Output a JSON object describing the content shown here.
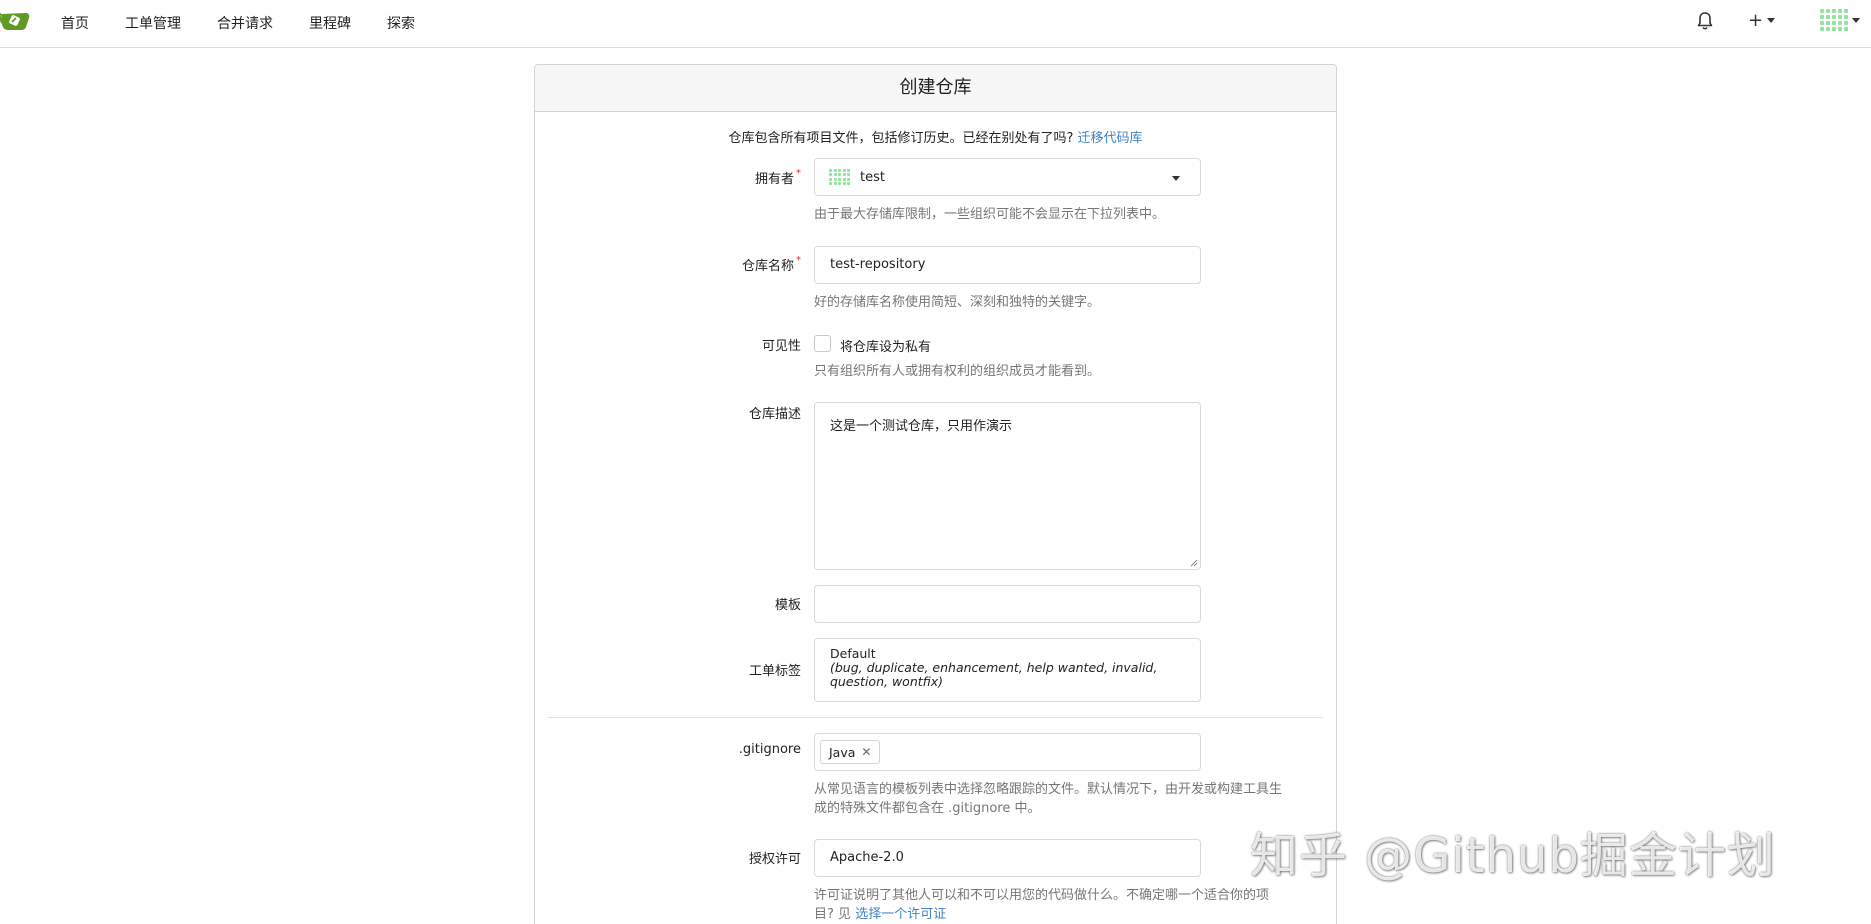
{
  "nav": {
    "items": [
      "首页",
      "工单管理",
      "合并请求",
      "里程碑",
      "探索"
    ],
    "plus_icon": "+"
  },
  "form": {
    "title": "创建仓库",
    "intro_text": "仓库包含所有项目文件，包括修订历史。已经在别处有了吗?",
    "intro_link": "迁移代码库",
    "owner": {
      "label": "拥有者",
      "required_mark": "*",
      "value": "test",
      "help": "由于最大存储库限制，一些组织可能不会显示在下拉列表中。"
    },
    "repo_name": {
      "label": "仓库名称",
      "required_mark": "*",
      "value": "test-repository",
      "help": "好的存储库名称使用简短、深刻和独特的关键字。"
    },
    "visibility": {
      "label": "可见性",
      "checkbox_label": "将仓库设为私有",
      "checked": false,
      "help": "只有组织所有人或拥有权利的组织成员才能看到。"
    },
    "description": {
      "label": "仓库描述",
      "value": "这是一个测试仓库，只用作演示"
    },
    "template": {
      "label": "模板",
      "value": ""
    },
    "issue_labels": {
      "label": "工单标签",
      "name": "Default",
      "desc_line1": "(bug, duplicate, enhancement, help wanted, invalid,",
      "desc_line2": "question, wontfix)"
    },
    "gitignore": {
      "label": ".gitignore",
      "tag": "Java",
      "help_line1": "从常见语言的模板列表中选择忽略跟踪的文件。默认情况下，由开发或构建工具生",
      "help_line2": "成的特殊文件都包含在 .gitignore 中。"
    },
    "license": {
      "label": "授权许可",
      "value": "Apache-2.0",
      "help_line1": "许可证说明了其他人可以和不可以用您的代码做什么。不确定哪一个适合你的项",
      "help_line2_prefix": "目? 见",
      "help_link": "选择一个许可证"
    }
  },
  "watermark": "知乎 @Github掘金计划",
  "colors": {
    "link": "#4183c4",
    "required": "#db2828",
    "avatar_dots": "#8fe39a",
    "logo_green": "#609926"
  }
}
